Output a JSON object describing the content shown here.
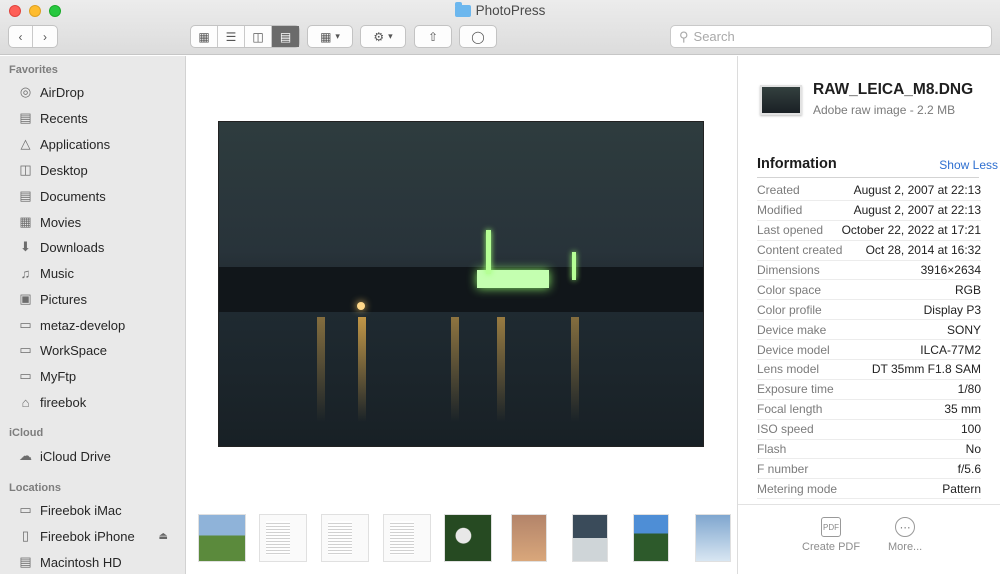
{
  "window": {
    "title": "PhotoPress"
  },
  "toolbar": {
    "search_placeholder": "Search",
    "icons": [
      "chevron-left-icon",
      "chevron-right-icon",
      "icon-view-icon",
      "list-view-icon",
      "column-view-icon",
      "gallery-view-icon",
      "group-icon",
      "gear-icon",
      "share-icon",
      "tag-icon",
      "search-icon"
    ]
  },
  "sidebar": {
    "favorites_label": "Favorites",
    "favorites": [
      {
        "label": "AirDrop",
        "icon": "airdrop-icon"
      },
      {
        "label": "Recents",
        "icon": "clock-icon"
      },
      {
        "label": "Applications",
        "icon": "applications-icon"
      },
      {
        "label": "Desktop",
        "icon": "desktop-icon"
      },
      {
        "label": "Documents",
        "icon": "document-icon"
      },
      {
        "label": "Movies",
        "icon": "film-icon"
      },
      {
        "label": "Downloads",
        "icon": "download-icon"
      },
      {
        "label": "Music",
        "icon": "music-icon"
      },
      {
        "label": "Pictures",
        "icon": "camera-icon"
      },
      {
        "label": "metaz-develop",
        "icon": "folder-icon"
      },
      {
        "label": "WorkSpace",
        "icon": "folder-icon"
      },
      {
        "label": "MyFtp",
        "icon": "folder-icon"
      },
      {
        "label": "fireebok",
        "icon": "home-icon"
      }
    ],
    "icloud_label": "iCloud",
    "icloud": [
      {
        "label": "iCloud Drive",
        "icon": "cloud-icon"
      }
    ],
    "locations_label": "Locations",
    "locations": [
      {
        "label": "Fireebok iMac",
        "icon": "imac-icon"
      },
      {
        "label": "Fireebok iPhone",
        "icon": "iphone-icon"
      },
      {
        "label": "Macintosh HD",
        "icon": "disk-icon"
      }
    ]
  },
  "inspector": {
    "file_name": "RAW_LEICA_M8.DNG",
    "file_kind": "Adobe raw image - 2.2 MB",
    "info_title": "Information",
    "show_less": "Show Less",
    "rows": [
      {
        "k": "Created",
        "v": "August 2, 2007 at 22:13"
      },
      {
        "k": "Modified",
        "v": "August 2, 2007 at 22:13"
      },
      {
        "k": "Last opened",
        "v": "October 22, 2022 at 17:21"
      },
      {
        "k": "Content created",
        "v": "Oct 28, 2014 at 16:32"
      },
      {
        "k": "Dimensions",
        "v": "3916×2634"
      },
      {
        "k": "Color space",
        "v": "RGB"
      },
      {
        "k": "Color profile",
        "v": "Display P3"
      },
      {
        "k": "Device make",
        "v": "SONY"
      },
      {
        "k": "Device model",
        "v": "ILCA-77M2"
      },
      {
        "k": "Lens model",
        "v": "DT 35mm F1.8 SAM"
      },
      {
        "k": "Exposure time",
        "v": "1/80"
      },
      {
        "k": "Focal length",
        "v": "35 mm"
      },
      {
        "k": "ISO speed",
        "v": "100"
      },
      {
        "k": "Flash",
        "v": "No"
      },
      {
        "k": "F number",
        "v": "f/5.6"
      },
      {
        "k": "Metering mode",
        "v": "Pattern"
      }
    ],
    "create_pdf": "Create PDF",
    "more": "More..."
  }
}
